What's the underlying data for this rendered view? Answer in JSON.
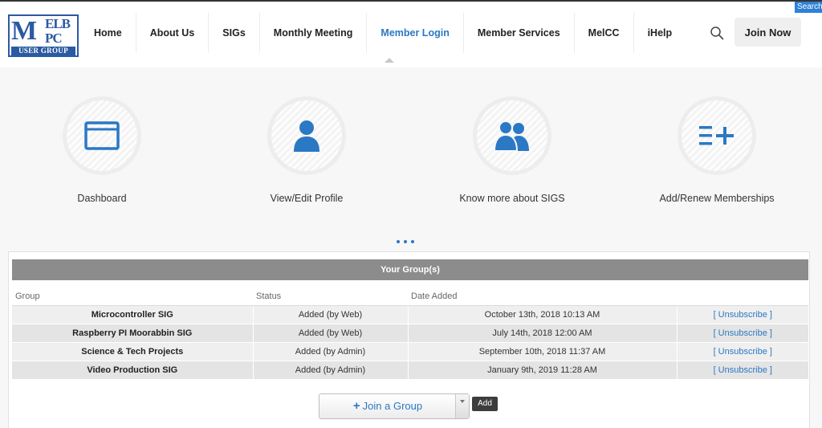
{
  "header": {
    "logo": {
      "big": "M",
      "small_top": "ELB",
      "small_bottom": "PC",
      "banner": "USER GROUP"
    },
    "nav": [
      {
        "label": "Home"
      },
      {
        "label": "About Us"
      },
      {
        "label": "SIGs"
      },
      {
        "label": "Monthly Meeting"
      },
      {
        "label": "Member Login",
        "active": true
      },
      {
        "label": "Member Services"
      },
      {
        "label": "MelCC"
      },
      {
        "label": "iHelp"
      }
    ],
    "join_label": "Join Now",
    "search_corner_label": "Search"
  },
  "tiles": [
    {
      "label": "Dashboard",
      "icon": "browser-window-icon"
    },
    {
      "label": "View/Edit Profile",
      "icon": "user-icon"
    },
    {
      "label": "Know more about SIGS",
      "icon": "users-icon"
    },
    {
      "label": "Add/Renew Memberships",
      "icon": "list-add-icon"
    }
  ],
  "groups": {
    "title": "Your Group(s)",
    "columns": [
      "Group",
      "Status",
      "Date Added",
      ""
    ],
    "rows": [
      {
        "group": "Microcontroller SIG",
        "status": "Added (by Web)",
        "date": "October 13th, 2018 10:13 AM",
        "action": "[ Unsubscribe ]"
      },
      {
        "group": "Raspberry PI Moorabbin SIG",
        "status": "Added (by Web)",
        "date": "July 14th, 2018 12:00 AM",
        "action": "[ Unsubscribe ]"
      },
      {
        "group": "Science & Tech Projects",
        "status": "Added (by Admin)",
        "date": "September 10th, 2018 11:37 AM",
        "action": "[ Unsubscribe ]"
      },
      {
        "group": "Video Production SIG",
        "status": "Added (by Admin)",
        "date": "January 9th, 2019 11:28 AM",
        "action": "[ Unsubscribe ]"
      }
    ],
    "join_select": {
      "plus": "+",
      "label": "Join a Group"
    },
    "add_label": "Add"
  },
  "colors": {
    "accent": "#2b78c5",
    "logo_blue": "#2b5aa3",
    "panel_title_bg": "#8c8c8c"
  }
}
